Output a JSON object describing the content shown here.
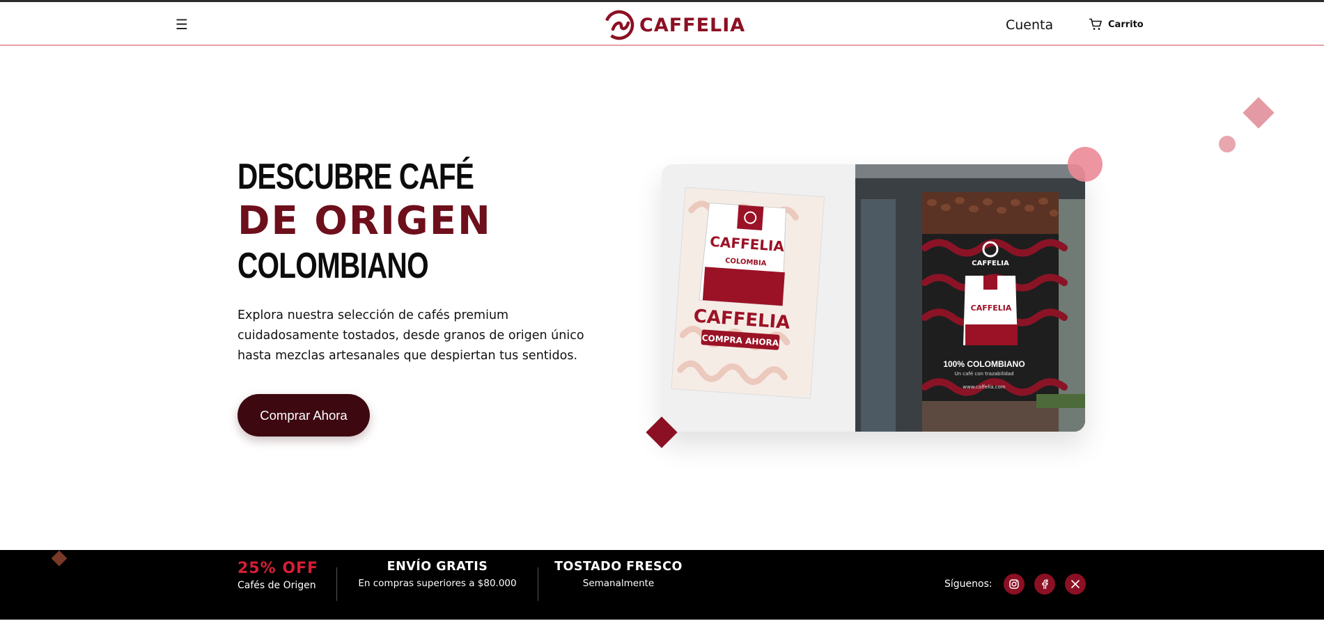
{
  "header": {
    "menu_icon": "hamburger-menu-icon",
    "brand": "CAFFELIA",
    "account_label": "Cuenta",
    "cart_label": "Carrito",
    "colors": {
      "brand": "#8c1023",
      "divider": "#e8a0aa"
    }
  },
  "hero": {
    "title_line1": "DESCUBRE CAFÉ",
    "title_line2": "DE ORIGEN",
    "title_line3": "COLOMBIANO",
    "description": "Explora nuestra selección de cafés premium cuidadosamente tostados, desde granos de origen único hasta mezclas artesanales que despiertan tus sentidos.",
    "cta_label": "Comprar Ahora",
    "colors": {
      "accent": "#6e0f1c",
      "cta": "#3d0810"
    }
  },
  "showcase": {
    "poster": {
      "brand": "CAFFELIA",
      "cta": "COMPRA AHORA",
      "bag_origin": "COLOMBIA"
    },
    "billboard": {
      "brand": "CAFFELIA",
      "headline": "100% COLOMBIANO",
      "tagline": "Un café con trazabilidad",
      "url": "www.caffelia.com"
    }
  },
  "promo_bar": {
    "discount": {
      "title": "25% OFF",
      "subtitle": "Cafés de Origen"
    },
    "shipping": {
      "title": "ENVÍO GRATIS",
      "subtitle": "En compras superiores a $80.000"
    },
    "roast": {
      "title": "TOSTADO FRESCO",
      "subtitle": "Semanalmente"
    },
    "social_label": "Síguenos:",
    "social": [
      {
        "icon": "instagram-icon"
      },
      {
        "icon": "facebook-icon"
      },
      {
        "icon": "x-twitter-icon"
      }
    ],
    "colors": {
      "background": "#000000",
      "discount": "#d61e35",
      "social_button": "#8c1023"
    }
  }
}
